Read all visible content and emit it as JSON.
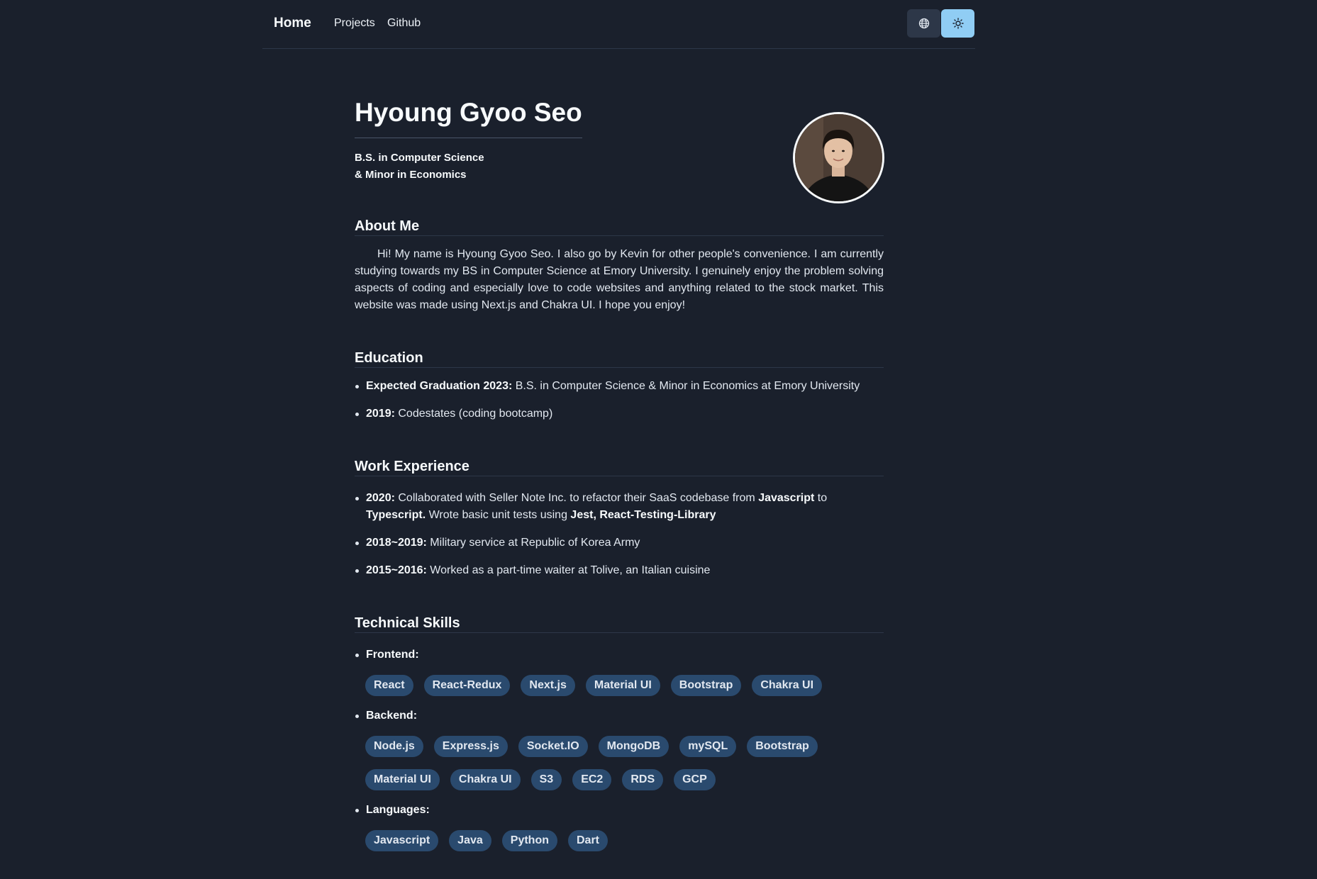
{
  "nav": {
    "home": "Home",
    "projects": "Projects",
    "github": "Github"
  },
  "profile": {
    "name": "Hyoung Gyoo Seo",
    "degree_line1": "B.S. in Computer Science",
    "degree_line2": "& Minor in Economics"
  },
  "about": {
    "title": "About Me",
    "text": "Hi! My name is Hyoung Gyoo Seo. I also go by Kevin for other people's convenience. I am currently studying towards my BS in Computer Science at Emory University. I genuinely enjoy the problem solving aspects of coding and especially love to code websites and anything related to the stock market. This website was made using Next.js and Chakra UI. I hope you enjoy!"
  },
  "education": {
    "title": "Education",
    "items": [
      {
        "label": "Expected Graduation 2023:",
        "text": " B.S. in Computer Science & Minor in Economics at Emory University"
      },
      {
        "label": "2019:",
        "text": " Codestates (coding bootcamp)"
      }
    ]
  },
  "work": {
    "title": "Work Experience",
    "item1": {
      "label": "2020:",
      "text1": " Collaborated with Seller Note Inc. to refactor their SaaS codebase from ",
      "js": "Javascript",
      "to": " to ",
      "ts": "Typescript.",
      "text2": " Wrote basic unit tests using ",
      "tools": "Jest, React-Testing-Library"
    },
    "item2": {
      "label": "2018~2019:",
      "text": " Military service at Republic of Korea Army"
    },
    "item3": {
      "label": "2015~2016:",
      "text": " Worked as a part-time waiter at Tolive, an Italian cuisine"
    }
  },
  "skills": {
    "title": "Technical Skills",
    "frontend_label": "Frontend:",
    "frontend": [
      "React",
      "React-Redux",
      "Next.js",
      "Material UI",
      "Bootstrap",
      "Chakra UI"
    ],
    "backend_label": "Backend:",
    "backend_row1": [
      "Node.js",
      "Express.js",
      "Socket.IO",
      "MongoDB",
      "mySQL",
      "Bootstrap"
    ],
    "backend_row2": [
      "Material UI",
      "Chakra UI",
      "S3",
      "EC2",
      "RDS",
      "GCP"
    ],
    "languages_label": "Languages:",
    "languages": [
      "Javascript",
      "Java",
      "Python",
      "Dart"
    ]
  },
  "icons": {
    "language": "globe-icon",
    "theme": "sun-icon"
  },
  "colors": {
    "background": "#1a202c",
    "tag": "#2a4a6e",
    "theme_button": "#90cdf4"
  }
}
